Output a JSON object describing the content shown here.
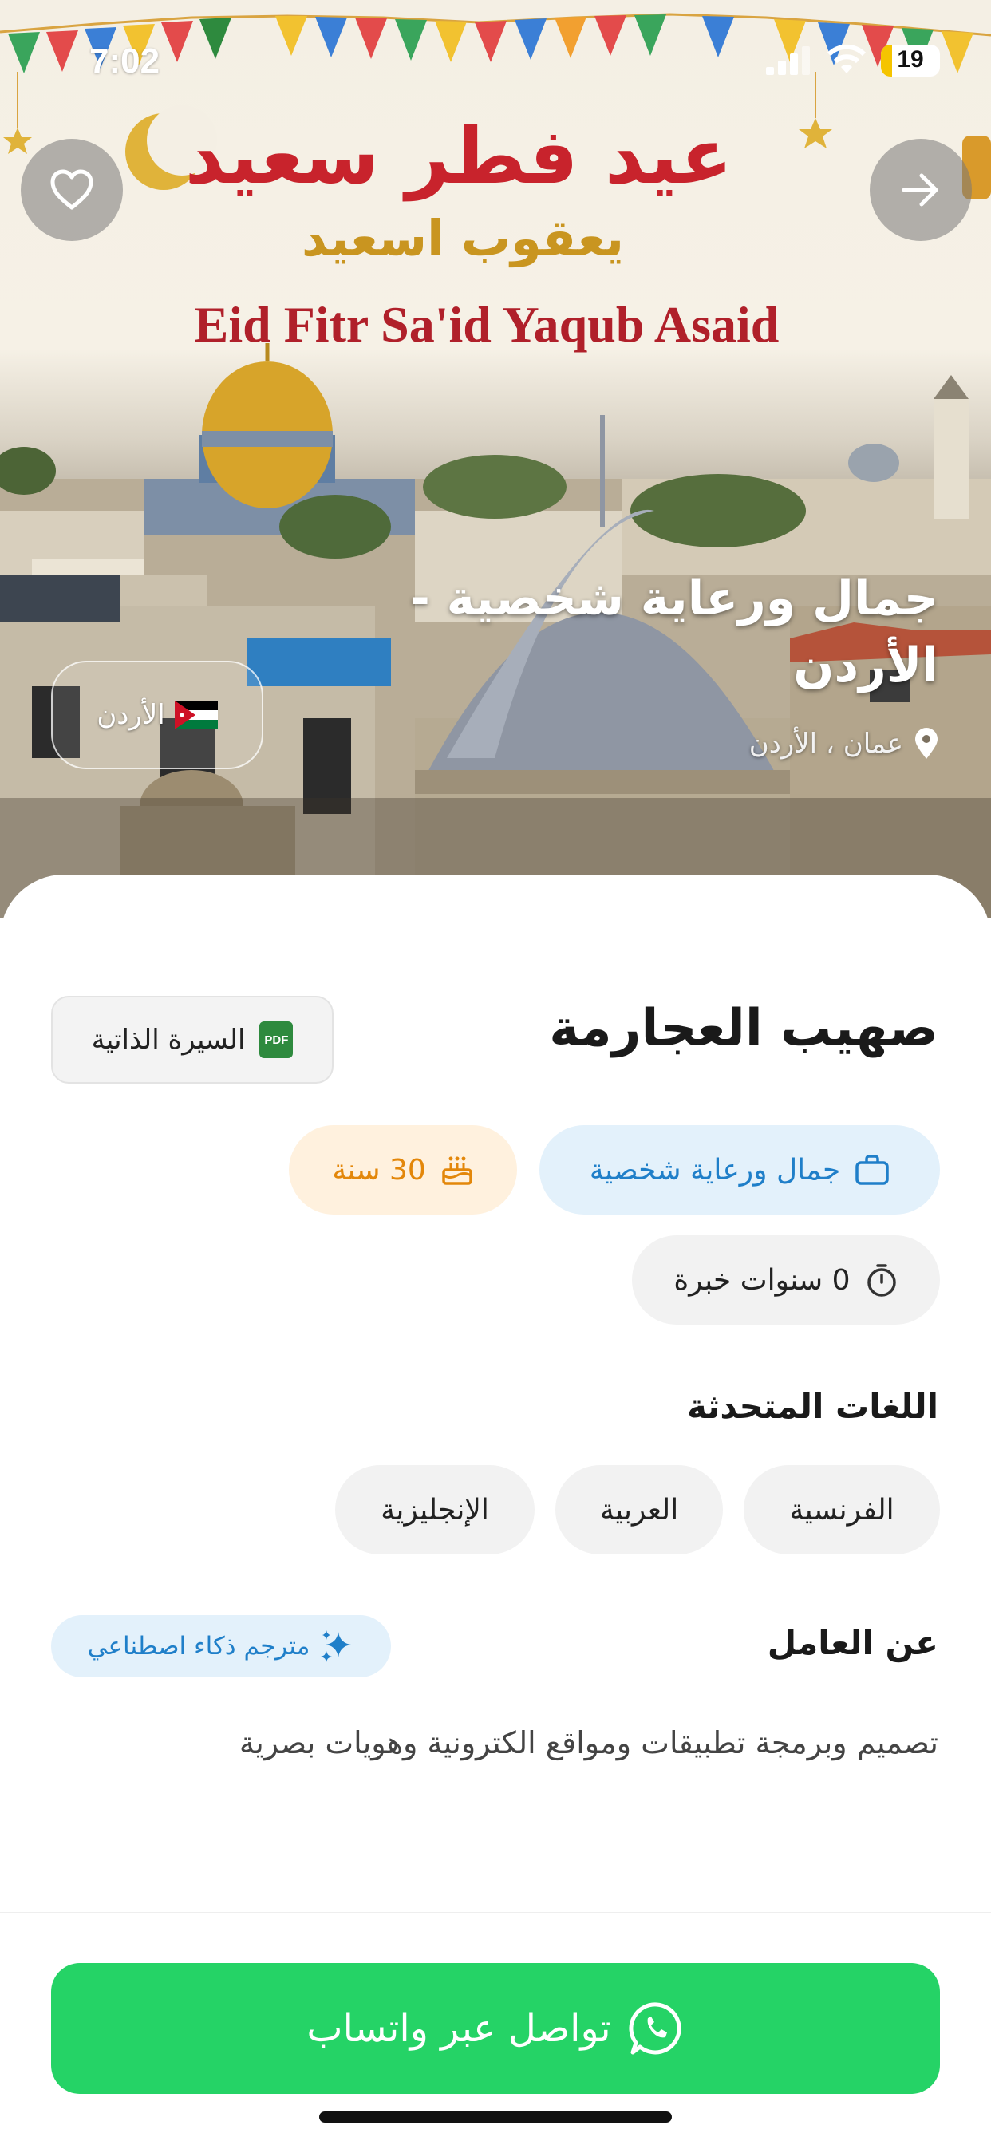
{
  "status_bar": {
    "time": "7:02",
    "battery": "19"
  },
  "banner": {
    "arabic_greeting": "عيد فطر سعيد",
    "arabic_name": "يعقوب اسعيد",
    "english_text": "Eid Fitr Sa'id Yaqub Asaid"
  },
  "hero": {
    "title": "جمال ورعاية شخصية - الأردن",
    "location": "عمان ، الأردن",
    "country_chip": "الأردن"
  },
  "profile": {
    "name": "صهيب العجارمة",
    "cv_button": "السيرة الذاتية",
    "pdf_label": "PDF",
    "category": "جمال ورعاية شخصية",
    "age": "30 سنة",
    "experience": "0 سنوات خبرة"
  },
  "languages": {
    "title": "اللغات المتحدثة",
    "items": [
      "الفرنسية",
      "العربية",
      "الإنجليزية"
    ]
  },
  "about": {
    "title": "عن العامل",
    "translator": "مترجم ذكاء اصطناعي",
    "text": "تصميم وبرمجة تطبيقات ومواقع الكترونية وهويات بصرية"
  },
  "cta": {
    "whatsapp": "تواصل عبر واتساب"
  },
  "colors": {
    "whatsapp_green": "#25d366",
    "category_blue": "#1f7fc9",
    "age_orange": "#e3870a",
    "banner_red": "#c8232c",
    "banner_gold": "#c99520"
  },
  "icons": [
    "heart-icon",
    "arrow-right-icon",
    "location-pin-icon",
    "jordan-flag-icon",
    "pdf-icon",
    "briefcase-icon",
    "cake-icon",
    "stopwatch-icon",
    "sparkle-icon",
    "whatsapp-icon"
  ]
}
